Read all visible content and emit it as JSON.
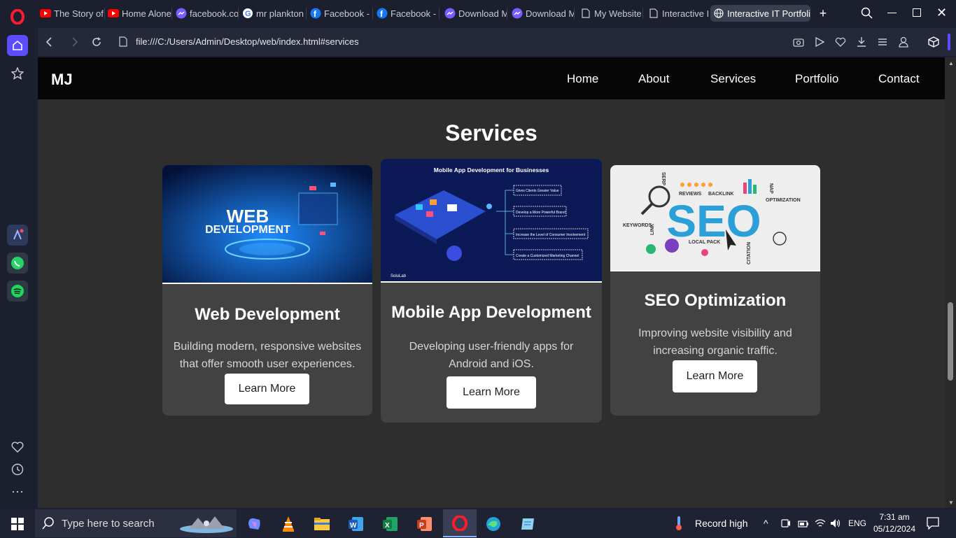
{
  "browser": {
    "tabs": [
      {
        "label": "The Story of",
        "icon": "youtube-icon"
      },
      {
        "label": "Home Alone",
        "icon": "youtube-icon"
      },
      {
        "label": "facebook.co",
        "icon": "messenger-icon"
      },
      {
        "label": "mr plankton",
        "icon": "google-icon"
      },
      {
        "label": "Facebook - l",
        "icon": "facebook-icon"
      },
      {
        "label": "Facebook - l",
        "icon": "facebook-icon"
      },
      {
        "label": "Download M",
        "icon": "messenger-icon"
      },
      {
        "label": "Download M",
        "icon": "messenger-icon"
      },
      {
        "label": "My Website",
        "icon": "document-icon"
      },
      {
        "label": "Interactive I",
        "icon": "document-icon"
      },
      {
        "label": "Interactive IT Portfolio",
        "icon": "globe-icon"
      }
    ],
    "url": "file:///C:/Users/Admin/Desktop/web/index.html#services"
  },
  "site": {
    "logo": "MJ",
    "nav": [
      "Home",
      "About",
      "Services",
      "Portfolio",
      "Contact"
    ],
    "section_title": "Services",
    "cards": [
      {
        "title": "Web Development",
        "description": "Building modern, responsive websites that offer smooth user experiences.",
        "button": "Learn More",
        "image_text": [
          "WEB",
          "DEVELOPMENT"
        ]
      },
      {
        "title": "Mobile App Development",
        "description": "Developing user-friendly apps for Android and iOS.",
        "button": "Learn More",
        "image_text": {
          "heading": "Mobile App Development for Businesses",
          "points": [
            "Gives Clients Greater Value",
            "Develop a More Powerful Brand",
            "Increase the Level of Consumer Involvement",
            "Create a Customized Marketing Channel"
          ],
          "brand": "SoluLab"
        }
      },
      {
        "title": "SEO Optimization",
        "description": "Improving website visibility and increasing organic traffic.",
        "button": "Learn More",
        "image_text": {
          "main": "SEO",
          "words": [
            "SERP",
            "REVIEWS",
            "BACKLINK",
            "NAP",
            "OPTIMIZATION",
            "KEYWORDS",
            "LINK",
            "LOCAL PACK",
            "CITATION"
          ]
        }
      }
    ]
  },
  "taskbar": {
    "search_placeholder": "Type here to search",
    "weather": "Record high",
    "language": "ENG",
    "time": "7:31 am",
    "date": "05/12/2024"
  },
  "colors": {
    "accent": "#5c4cff",
    "page_bg": "#2e2e2e",
    "card_bg": "#424242",
    "nav_bg": "#060606"
  }
}
